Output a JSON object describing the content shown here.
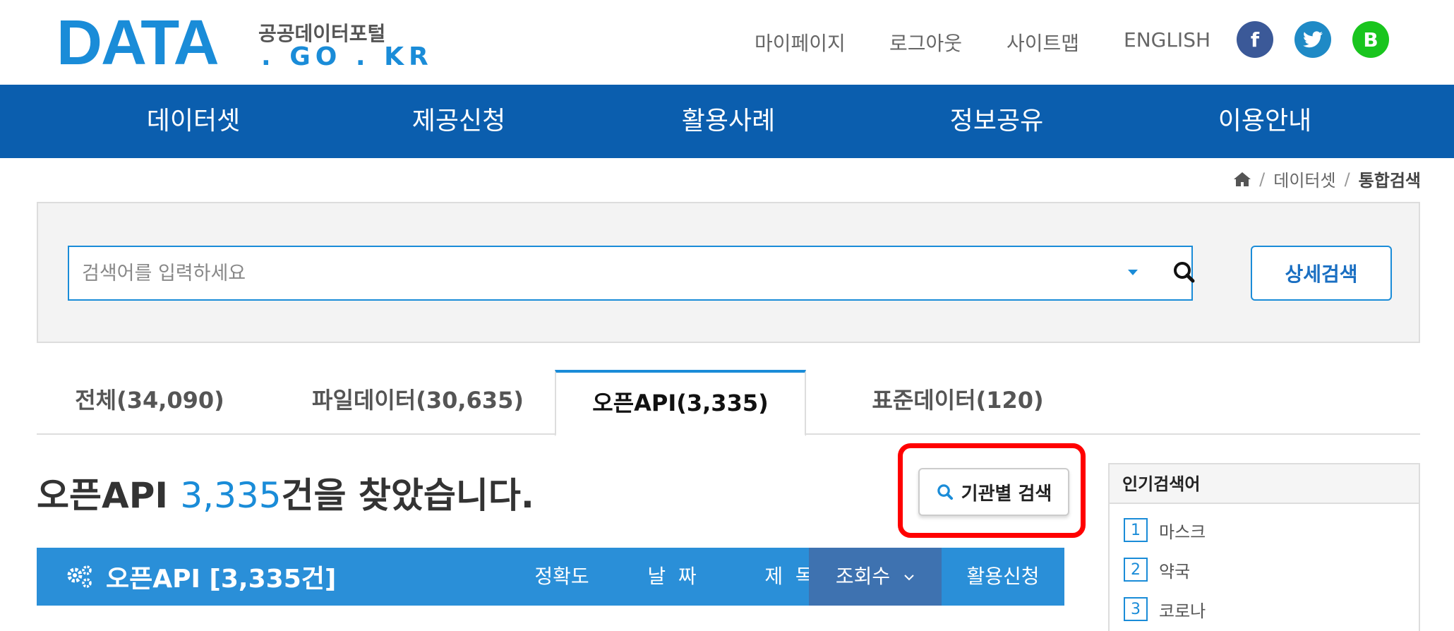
{
  "logo": {
    "main": "DATA",
    "korean": "공공데이터포털",
    "domain": ". GO . KR"
  },
  "util_links": [
    "마이페이지",
    "로그아웃",
    "사이트맵",
    "ENGLISH"
  ],
  "social": {
    "facebook": "f",
    "blog": "B"
  },
  "gnb": [
    "데이터셋",
    "제공신청",
    "활용사례",
    "정보공유",
    "이용안내"
  ],
  "breadcrumb": {
    "home_icon": "home-icon",
    "level1": "데이터셋",
    "current": "통합검색",
    "separator": "/"
  },
  "search": {
    "placeholder": "검색어를 입력하세요",
    "value": "",
    "advanced_label": "상세검색"
  },
  "tabs": [
    {
      "label": "전체(34,090)",
      "active": false
    },
    {
      "label": "파일데이터(30,635)",
      "active": false
    },
    {
      "label": "오픈API(3,335)",
      "active": true
    },
    {
      "label": "표준데이터(120)",
      "active": false
    }
  ],
  "result": {
    "prefix": "오픈API ",
    "count": "3,335",
    "suffix": "건을 찾았습니다."
  },
  "org_search_label": "기관별 검색",
  "sortbar": {
    "title": "오픈API [3,335건]",
    "items": [
      "정확도",
      "날  짜",
      "제  목",
      "조회수",
      "활용신청"
    ],
    "active": "조회수"
  },
  "popular": {
    "title": "인기검색어",
    "items": [
      {
        "rank": "1",
        "keyword": "마스크"
      },
      {
        "rank": "2",
        "keyword": "약국"
      },
      {
        "rank": "3",
        "keyword": "코로나"
      }
    ]
  },
  "colors": {
    "brand_blue": "#0b5eae",
    "accent": "#1a8cd8",
    "highlight_box": "#ff0000"
  }
}
